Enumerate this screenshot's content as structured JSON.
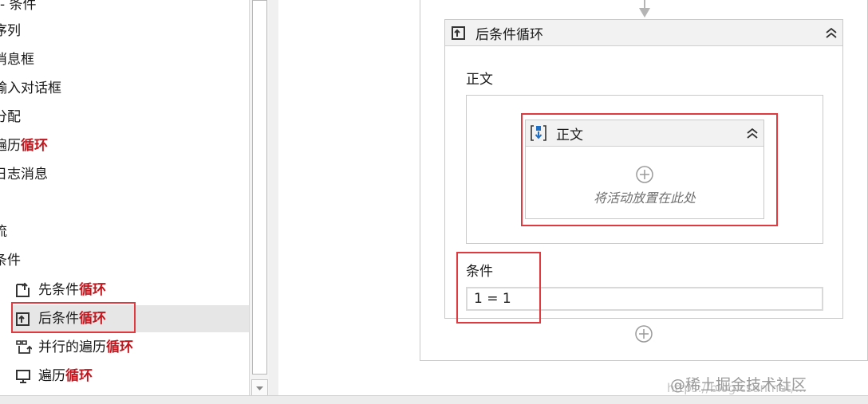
{
  "toolbox": {
    "items": [
      {
        "label": "- 条件",
        "highlight": ""
      },
      {
        "label": "序列",
        "highlight": ""
      },
      {
        "label": "消息框",
        "highlight": ""
      },
      {
        "label": "输入对话框",
        "highlight": ""
      },
      {
        "label": "分配",
        "highlight": ""
      },
      {
        "label": "遍历",
        "highlight": "循环"
      },
      {
        "label": "日志消息",
        "highlight": ""
      },
      {
        "label": "流",
        "highlight": ""
      },
      {
        "label": "条件",
        "highlight": ""
      }
    ],
    "loops": [
      {
        "label": "先条件",
        "highlight": "循环",
        "icon": "pre-condition-loop-icon"
      },
      {
        "label": "后条件",
        "highlight": "循环",
        "icon": "post-condition-loop-icon"
      },
      {
        "label": "并行的遍历",
        "highlight": "循环",
        "icon": "parallel-foreach-icon"
      },
      {
        "label": "遍历",
        "highlight": "循环",
        "icon": "foreach-icon"
      }
    ]
  },
  "designer": {
    "activity_title": "后条件循环",
    "body_label": "正文",
    "inner_title": "正文",
    "drop_hint": "将活动放置在此处",
    "condition_label": "条件",
    "condition_value": "1 = 1",
    "collapse_glyph": "⌃"
  },
  "watermark": {
    "main": "@稀土掘金技术社区",
    "sub": "https://blog.csdn.net/..."
  },
  "colors": {
    "highlight": "#c0161e",
    "annotation": "#e0393f"
  }
}
